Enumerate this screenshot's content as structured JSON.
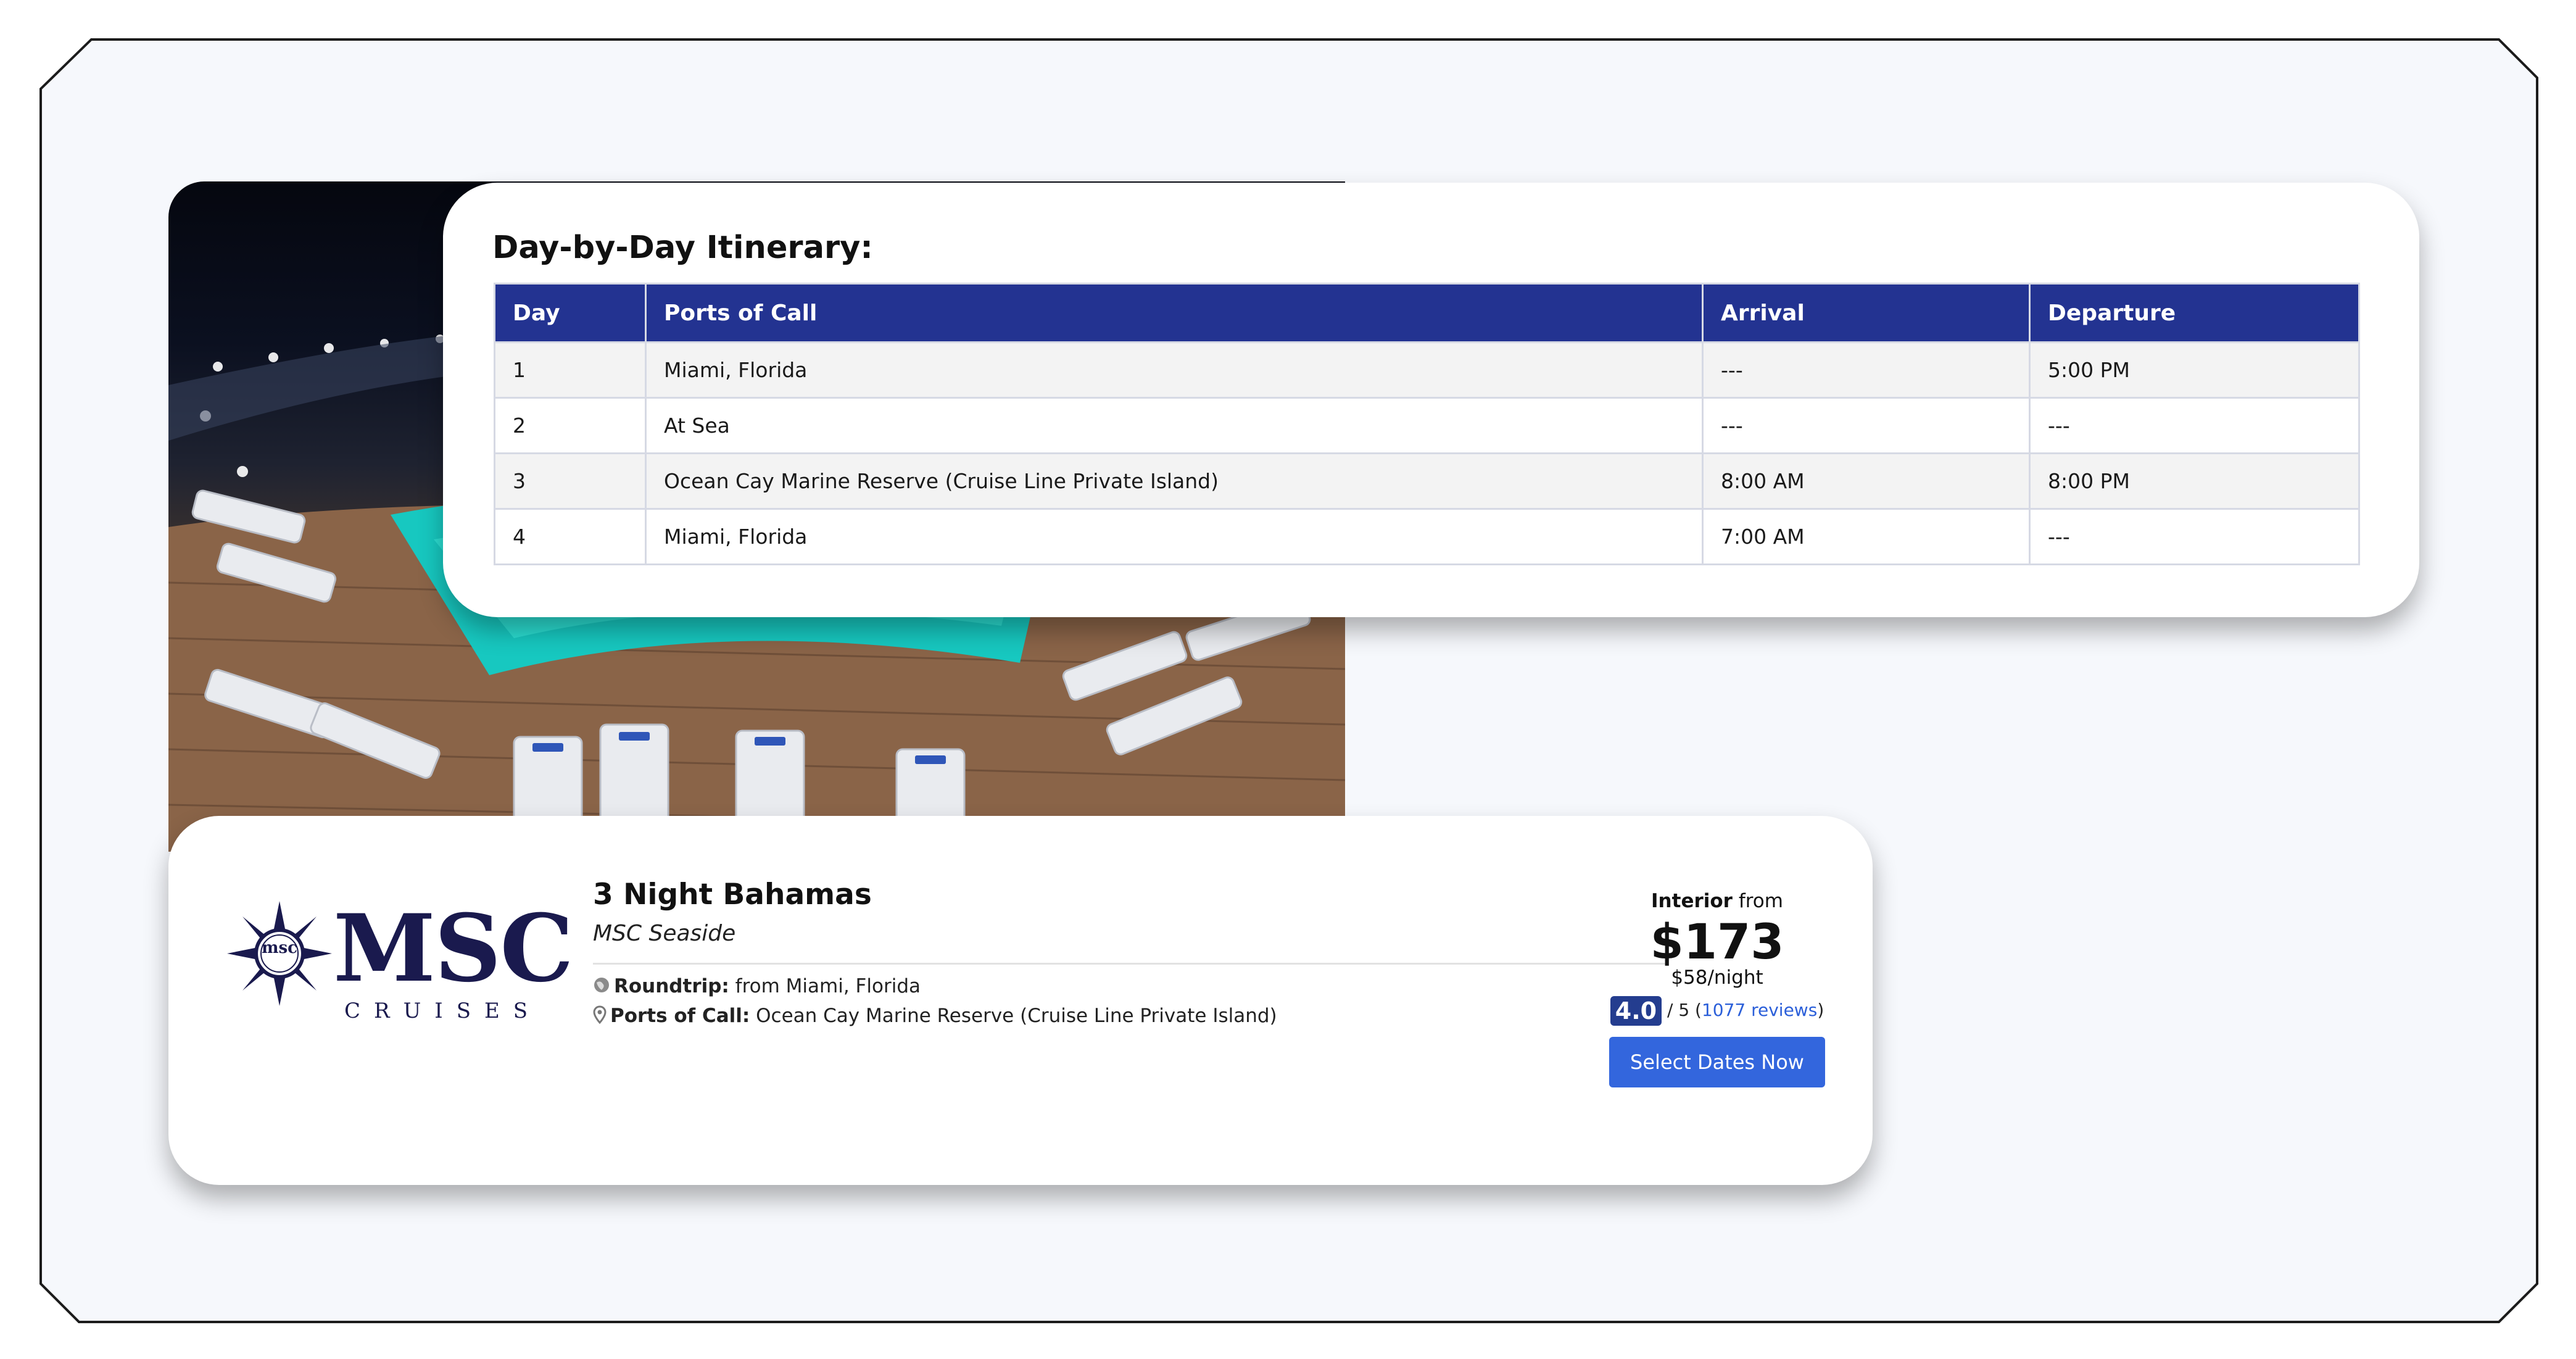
{
  "itinerary": {
    "title": "Day-by-Day Itinerary:",
    "columns": [
      "Day",
      "Ports of Call",
      "Arrival",
      "Departure"
    ],
    "rows": [
      {
        "day": "1",
        "port": "Miami, Florida",
        "arrival": "---",
        "departure": "5:00 PM"
      },
      {
        "day": "2",
        "port": "At Sea",
        "arrival": "---",
        "departure": "---"
      },
      {
        "day": "3",
        "port": "Ocean Cay Marine Reserve (Cruise Line Private Island)",
        "arrival": "8:00 AM",
        "departure": "8:00 PM"
      },
      {
        "day": "4",
        "port": "Miami, Florida",
        "arrival": "7:00 AM",
        "departure": "---"
      }
    ]
  },
  "listing": {
    "logo": {
      "word": "MSC",
      "sub": "CRUISES",
      "emblem": "msc"
    },
    "title": "3 Night Bahamas",
    "ship": "MSC Seaside",
    "roundtrip_label": "Roundtrip:",
    "roundtrip_value": " from Miami, Florida",
    "ports_label": "Ports of Call:",
    "ports_value": " Ocean Cay Marine Reserve (Cruise Line Private Island)",
    "cabin_type": "Interior",
    "from_label": " from",
    "price": "$173",
    "per_night": "$58/night",
    "rating": "4.0",
    "rating_scale": " / 5 (",
    "reviews": "1077 reviews",
    "reviews_close": ")",
    "cta": "Select Dates Now",
    "icons": {
      "roundtrip": "globe-icon",
      "ports": "map-pin-icon"
    }
  },
  "colors": {
    "header_navy": "#233391",
    "button_blue": "#3366dd",
    "logo_navy": "#1a1a4e",
    "frame_bg": "#f6f8fc"
  }
}
